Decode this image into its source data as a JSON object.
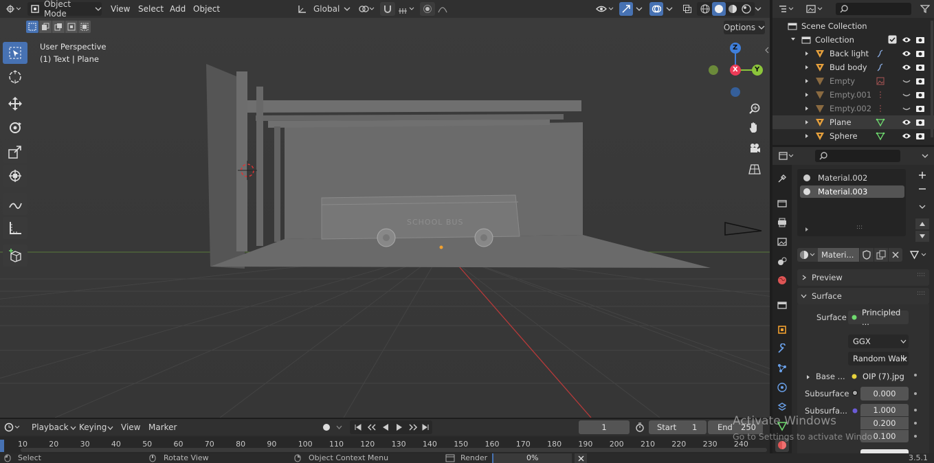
{
  "header": {
    "mode": "Object Mode",
    "menus": [
      "View",
      "Select",
      "Add",
      "Object"
    ],
    "transform_orientation": "Global",
    "options_label": "Options"
  },
  "viewport": {
    "perspective": "User Perspective",
    "object_info": "(1) Text | Plane",
    "bus_text": "SCHOOL BUS",
    "gizmo_axes": {
      "z": "Z",
      "x": "X",
      "y": "Y"
    },
    "axis_colors": {
      "x": "#ed3b57",
      "y": "#8cc53b",
      "z": "#3f7fdb"
    }
  },
  "outliner": {
    "root": "Scene Collection",
    "collection": "Collection",
    "items": [
      {
        "name": "Back light",
        "type": "light",
        "dim": false
      },
      {
        "name": "Bud body",
        "type": "light",
        "dim": false
      },
      {
        "name": "Empty",
        "type": "image",
        "dim": true
      },
      {
        "name": "Empty.001",
        "type": "empty",
        "dim": true
      },
      {
        "name": "Empty.002",
        "type": "empty",
        "dim": true
      },
      {
        "name": "Plane",
        "type": "mesh",
        "dim": false
      },
      {
        "name": "Sphere",
        "type": "mesh",
        "dim": false
      }
    ]
  },
  "properties": {
    "material_slots": [
      "Material.002",
      "Material.003"
    ],
    "material_name": "Materi...",
    "preview_label": "Preview",
    "surface_label": "Surface",
    "surface_field_label": "Surface",
    "surface_shader": "Principled ...",
    "distribution": "GGX",
    "subsurface_method": "Random Walk",
    "base_color_label": "Base ...",
    "base_color_value": "OIP (7).jpg",
    "subsurface_label": "Subsurface",
    "subsurface_value": "0.000",
    "subsurface_radius_label": "Subsurfa...",
    "subsurface_radius": [
      "1.000",
      "0.200",
      "0.100"
    ]
  },
  "timeline": {
    "menus": [
      "Playback",
      "Keying",
      "View",
      "Marker"
    ],
    "current_frame": "1",
    "start_label": "Start",
    "start_value": "1",
    "end_label": "End",
    "end_value": "250",
    "ticks": [
      "10",
      "20",
      "30",
      "40",
      "50",
      "60",
      "70",
      "80",
      "90",
      "100",
      "110",
      "120",
      "130",
      "140",
      "150",
      "160",
      "170",
      "180",
      "190",
      "200",
      "210",
      "220",
      "230",
      "240"
    ]
  },
  "statusbar": {
    "select": "Select",
    "rotate": "Rotate View",
    "context": "Object Context Menu",
    "render": "Render",
    "progress": "0%",
    "version": "3.5.1"
  },
  "watermark": {
    "title": "Activate Windows",
    "subtitle": "Go to Settings to activate Windo"
  }
}
